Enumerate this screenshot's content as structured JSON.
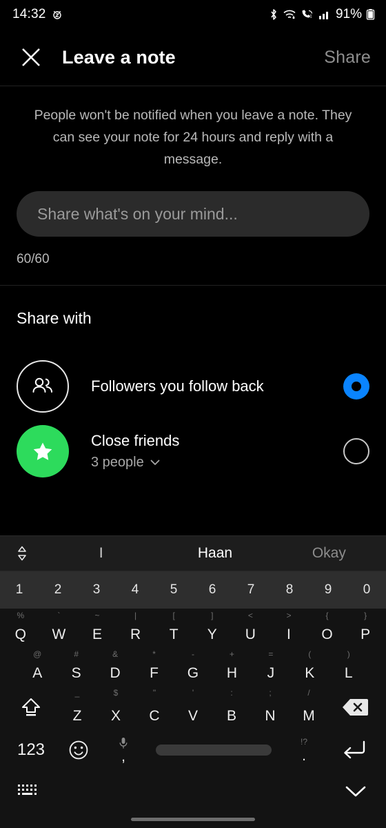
{
  "status_bar": {
    "time": "14:32",
    "left_icons": [
      "alarm-snooze-icon"
    ],
    "battery_percent": "91%",
    "right_icons": [
      "bluetooth-icon",
      "wifi-icon",
      "volte-call-icon",
      "signal-bars-icon",
      "battery-icon"
    ]
  },
  "app_bar": {
    "close_icon": "close-icon",
    "title": "Leave a note",
    "share_label": "Share",
    "share_enabled": false,
    "share_color": "#8e8e8e"
  },
  "note": {
    "description": "People won't be notified when you leave a note. They can see your note for 24 hours and reply with a message.",
    "input_value": "",
    "input_placeholder": "Share what's on your mind...",
    "counter": "60/60"
  },
  "share_with": {
    "title": "Share with",
    "options": [
      {
        "label": "Followers you follow back",
        "sub": "",
        "icon": "two-people-icon",
        "avatar_style": "outline",
        "selected": true
      },
      {
        "label": "Close friends",
        "sub": "3 people",
        "chevron": "chevron-down-icon",
        "icon": "star-icon",
        "avatar_style": "green",
        "avatar_color": "#2ddb5c",
        "selected": false
      }
    ],
    "selected_color": "#0a84ff"
  },
  "keyboard": {
    "expand_icon": "expand-suggestions-icon",
    "suggestions": [
      "I",
      "Haan",
      "Okay"
    ],
    "number_row": [
      "1",
      "2",
      "3",
      "4",
      "5",
      "6",
      "7",
      "8",
      "9",
      "0"
    ],
    "row_q": [
      {
        "main": "Q",
        "sup": "%"
      },
      {
        "main": "W",
        "sup": "`"
      },
      {
        "main": "E",
        "sup": "~"
      },
      {
        "main": "R",
        "sup": "|"
      },
      {
        "main": "T",
        "sup": "["
      },
      {
        "main": "Y",
        "sup": "]"
      },
      {
        "main": "U",
        "sup": "<"
      },
      {
        "main": "I",
        "sup": ">"
      },
      {
        "main": "O",
        "sup": "{"
      },
      {
        "main": "P",
        "sup": "}"
      }
    ],
    "row_a": [
      {
        "main": "A",
        "sup": "@"
      },
      {
        "main": "S",
        "sup": "#"
      },
      {
        "main": "D",
        "sup": "&"
      },
      {
        "main": "F",
        "sup": "*"
      },
      {
        "main": "G",
        "sup": "-"
      },
      {
        "main": "H",
        "sup": "+"
      },
      {
        "main": "J",
        "sup": "="
      },
      {
        "main": "K",
        "sup": "("
      },
      {
        "main": "L",
        "sup": ")"
      }
    ],
    "row_z": [
      {
        "main": "Z",
        "sup": "_"
      },
      {
        "main": "X",
        "sup": "$"
      },
      {
        "main": "C",
        "sup": "\""
      },
      {
        "main": "V",
        "sup": "'"
      },
      {
        "main": "B",
        "sup": ":"
      },
      {
        "main": "N",
        "sup": ";"
      },
      {
        "main": "M",
        "sup": "/"
      }
    ],
    "shift_icon": "shift-caps-icon",
    "backspace_icon": "backspace-icon",
    "numeric_label": "123",
    "emoji_icon": "emoji-smiley-icon",
    "mic_icon": "microphone-icon",
    "comma_label": ",",
    "space_key": "spacebar",
    "period_sup": "!?",
    "period_label": ".",
    "enter_icon": "enter-return-icon",
    "layout_icon": "keyboard-layout-icon",
    "hide_icon": "chevron-down-hide-keyboard-icon"
  }
}
